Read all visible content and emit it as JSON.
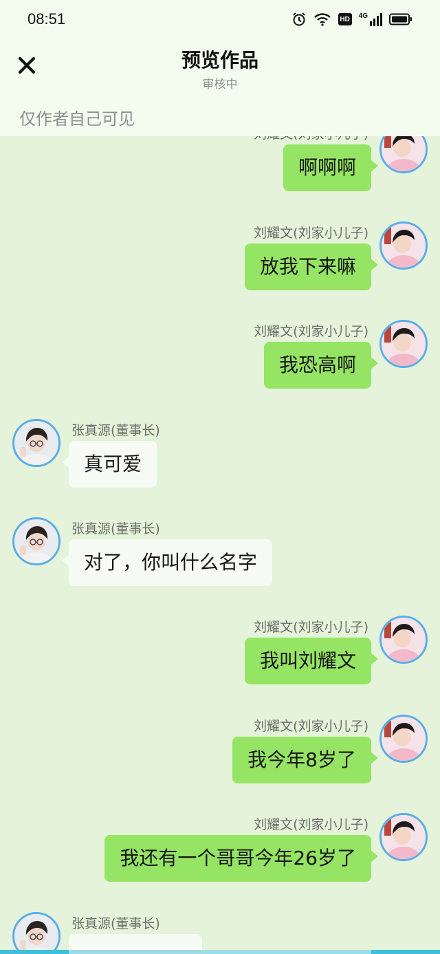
{
  "status_bar": {
    "time": "08:51",
    "icons": [
      "alarm-icon",
      "wifi-icon",
      "hd-icon",
      "4g-signal-icon",
      "battery-icon"
    ],
    "hd_label": "HD",
    "network_label": "4G"
  },
  "header": {
    "close_icon": "close-icon",
    "title": "预览作品",
    "subtitle": "审核中",
    "visibility_note": "仅作者自己可见"
  },
  "colors": {
    "background": "#e4f3d9",
    "header_bg": "#f3fcef",
    "self_bubble": "#95e463",
    "other_bubble": "#f7fbf6",
    "avatar_ring": "#5aaee8"
  },
  "messages": [
    {
      "side": "right",
      "sender": "刘耀文(刘家小儿子)",
      "text": "啊啊啊"
    },
    {
      "side": "right",
      "sender": "刘耀文(刘家小儿子)",
      "text": "放我下来嘛"
    },
    {
      "side": "right",
      "sender": "刘耀文(刘家小儿子)",
      "text": "我恐高啊"
    },
    {
      "side": "left",
      "sender": "张真源(董事长)",
      "text": "真可爱"
    },
    {
      "side": "left",
      "sender": "张真源(董事长)",
      "text": "对了，你叫什么名字"
    },
    {
      "side": "right",
      "sender": "刘耀文(刘家小儿子)",
      "text": "我叫刘耀文"
    },
    {
      "side": "right",
      "sender": "刘耀文(刘家小儿子)",
      "text": "我今年8岁了"
    },
    {
      "side": "right",
      "sender": "刘耀文(刘家小儿子)",
      "text": "我还有一个哥哥今年26岁了"
    },
    {
      "side": "left",
      "sender": "张真源(董事长)",
      "text": ""
    }
  ]
}
